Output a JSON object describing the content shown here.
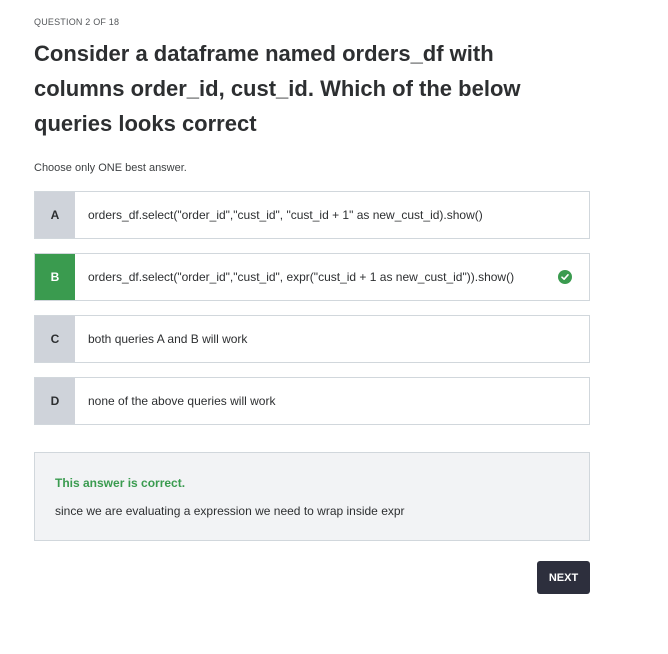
{
  "quiz": {
    "counter": "QUESTION 2 OF 18",
    "question": "Consider a dataframe named orders_df with columns order_id, cust_id. Which of the below queries looks correct",
    "instruction": "Choose only ONE best answer.",
    "options": [
      {
        "letter": "A",
        "text": "orders_df.select(\"order_id\",\"cust_id\", \"cust_id + 1\" as new_cust_id).show()",
        "selected": false
      },
      {
        "letter": "B",
        "text": "orders_df.select(\"order_id\",\"cust_id\", expr(\"cust_id + 1 as new_cust_id\")).show()",
        "selected": true,
        "status_icon": "check-circle-icon"
      },
      {
        "letter": "C",
        "text": "both queries A and B will work",
        "selected": false
      },
      {
        "letter": "D",
        "text": "none of the above queries will work",
        "selected": false
      }
    ],
    "feedback": {
      "title": "This answer is correct.",
      "explanation": "since we are evaluating a expression we need to wrap inside expr"
    },
    "next_label": "NEXT"
  },
  "colors": {
    "correct_green": "#3a9b4f",
    "letter_gray": "#cfd3da",
    "button_dark": "#2d2f3d",
    "feedback_bg": "#f2f3f5"
  }
}
